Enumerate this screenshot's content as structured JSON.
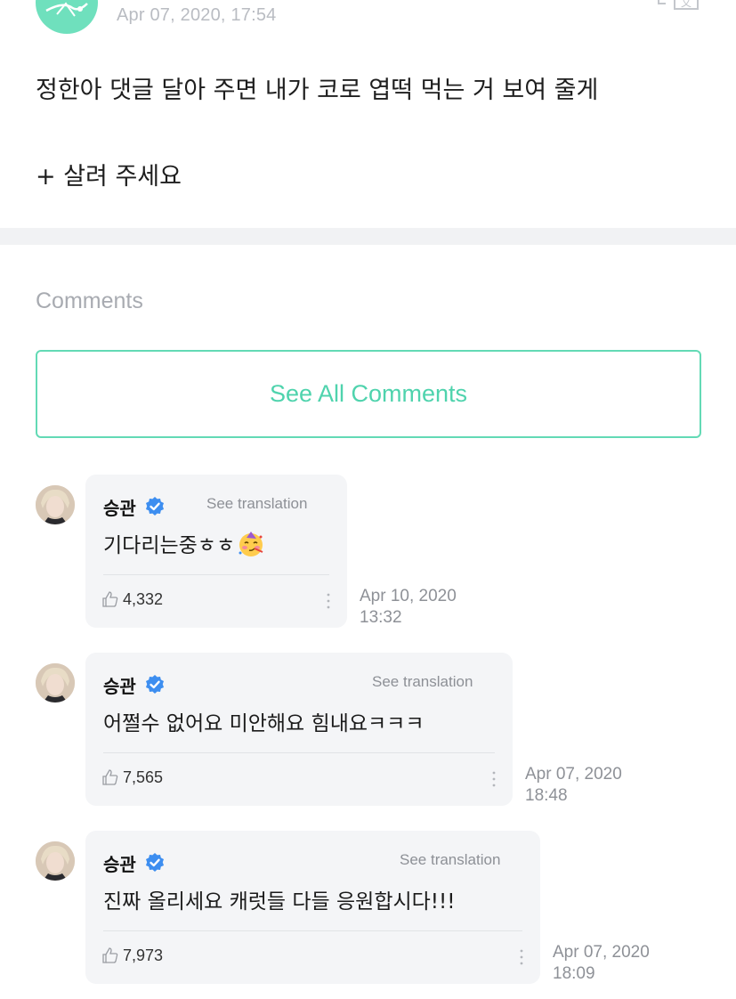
{
  "post": {
    "date": "Apr 07, 2020, 17:54",
    "lines": [
      "정한아 댓글 달아 주면 내가 코로 엽떡 먹는 거 보여 줄게",
      "+ 살려 주세요"
    ]
  },
  "comments_section": {
    "title": "Comments",
    "see_all_label": "See All Comments"
  },
  "comments": [
    {
      "author": "승관",
      "see_translation": "See translation",
      "text": "기다리는중ㅎㅎ",
      "emoji": "partying-face",
      "likes": "4,332",
      "date_line1": "Apr 10, 2020",
      "date_line2": "13:32"
    },
    {
      "author": "승관",
      "see_translation": "See translation",
      "text": "어쩔수 없어요 미안해요 힘내요ㅋㅋㅋ",
      "likes": "7,565",
      "date_line1": "Apr 07, 2020",
      "date_line2": "18:48"
    },
    {
      "author": "승관",
      "see_translation": "See translation",
      "text": "진짜 올리세요 캐럿들 다들 응원합시다!!!",
      "likes": "7,973",
      "date_line1": "Apr 07, 2020",
      "date_line2": "18:09"
    }
  ],
  "colors": {
    "accent": "#4fd3ad",
    "verified": "#3d8ef0",
    "bubble": "#f4f5f7"
  },
  "icons": [
    "translate-icon",
    "verified-badge-icon",
    "thumbs-up-icon",
    "more-options-icon"
  ]
}
